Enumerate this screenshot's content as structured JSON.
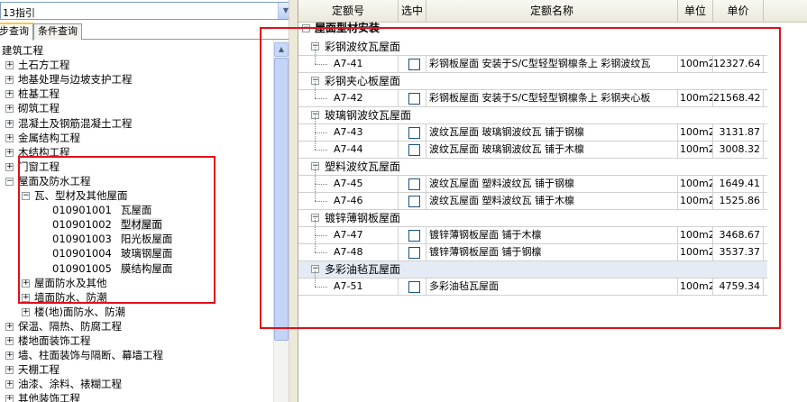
{
  "left": {
    "combo_value": "13指引",
    "tab_active": "步查询",
    "tab_other": "条件查询",
    "tree": [
      {
        "label": "建筑工程",
        "level": 0,
        "exp": ""
      },
      {
        "label": "土石方工程",
        "level": 1,
        "exp": "+"
      },
      {
        "label": "地基处理与边坡支护工程",
        "level": 1,
        "exp": "+"
      },
      {
        "label": "桩基工程",
        "level": 1,
        "exp": "+"
      },
      {
        "label": "砌筑工程",
        "level": 1,
        "exp": "+"
      },
      {
        "label": "混凝土及钢筋混凝土工程",
        "level": 1,
        "exp": "+"
      },
      {
        "label": "金属结构工程",
        "level": 1,
        "exp": "+"
      },
      {
        "label": "木结构工程",
        "level": 1,
        "exp": "+"
      },
      {
        "label": "门窗工程",
        "level": 1,
        "exp": "+"
      },
      {
        "label": "屋面及防水工程",
        "level": 1,
        "exp": "−"
      },
      {
        "label": "瓦、型材及其他屋面",
        "level": 2,
        "exp": "−"
      },
      {
        "code": "010901001",
        "label": "瓦屋面",
        "level": 3,
        "exp": ""
      },
      {
        "code": "010901002",
        "label": "型材屋面",
        "level": 3,
        "exp": "",
        "selected": true
      },
      {
        "code": "010901003",
        "label": "阳光板屋面",
        "level": 3,
        "exp": ""
      },
      {
        "code": "010901004",
        "label": "玻璃钢屋面",
        "level": 3,
        "exp": ""
      },
      {
        "code": "010901005",
        "label": "膜结构屋面",
        "level": 3,
        "exp": ""
      },
      {
        "label": "屋面防水及其他",
        "level": 2,
        "exp": "+"
      },
      {
        "label": "墙面防水、防潮",
        "level": 2,
        "exp": "+"
      },
      {
        "label": "楼(地)面防水、防潮",
        "level": 2,
        "exp": "+"
      },
      {
        "label": "保温、隔热、防腐工程",
        "level": 1,
        "exp": "+"
      },
      {
        "label": "楼地面装饰工程",
        "level": 1,
        "exp": "+"
      },
      {
        "label": "墙、柱面装饰与隔断、幕墙工程",
        "level": 1,
        "exp": "+"
      },
      {
        "label": "天棚工程",
        "level": 1,
        "exp": "+"
      },
      {
        "label": "油漆、涂料、裱糊工程",
        "level": 1,
        "exp": "+"
      },
      {
        "label": "其他装饰工程",
        "level": 1,
        "exp": "+"
      }
    ]
  },
  "grid": {
    "headers": [
      "定额号",
      "选中",
      "定额名称",
      "单位",
      "单价"
    ],
    "section_title": "屋面型材安装",
    "rows": [
      {
        "type": "group",
        "label": "彩钢波纹瓦屋面"
      },
      {
        "type": "item",
        "code": "A7-41",
        "name": "彩钢板屋面 安装于S/C型轻型钢檩条上 彩钢波纹瓦",
        "unit": "100m2",
        "price": "12327.64"
      },
      {
        "type": "group",
        "label": "彩钢夹心板屋面"
      },
      {
        "type": "item",
        "code": "A7-42",
        "name": "彩钢板屋面 安装于S/C型轻型钢檩条上 彩钢夹心板",
        "unit": "100m2",
        "price": "21568.42"
      },
      {
        "type": "group",
        "label": "玻璃钢波纹瓦屋面"
      },
      {
        "type": "item",
        "code": "A7-43",
        "name": "波纹瓦屋面 玻璃钢波纹瓦 铺于钢檩",
        "unit": "100m2",
        "price": "3131.87"
      },
      {
        "type": "item",
        "code": "A7-44",
        "name": "波纹瓦屋面 玻璃钢波纹瓦 铺于木檩",
        "unit": "100m2",
        "price": "3008.32"
      },
      {
        "type": "group",
        "label": "塑料波纹瓦屋面"
      },
      {
        "type": "item",
        "code": "A7-45",
        "name": "波纹瓦屋面 塑料波纹瓦 铺于钢檩",
        "unit": "100m2",
        "price": "1649.41"
      },
      {
        "type": "item",
        "code": "A7-46",
        "name": "波纹瓦屋面 塑料波纹瓦 铺于木檩",
        "unit": "100m2",
        "price": "1525.86"
      },
      {
        "type": "group",
        "label": "镀锌薄钢板屋面"
      },
      {
        "type": "item",
        "code": "A7-47",
        "name": "镀锌薄钢板屋面 铺于木檩",
        "unit": "100m2",
        "price": "3468.67"
      },
      {
        "type": "item",
        "code": "A7-48",
        "name": "镀锌薄钢板屋面 铺于钢檩",
        "unit": "100m2",
        "price": "3537.37"
      },
      {
        "type": "group",
        "label": "多彩油毡瓦屋面",
        "highlight": true
      },
      {
        "type": "item",
        "code": "A7-51",
        "name": "多彩油毡瓦屋面",
        "unit": "100m2",
        "price": "4759.34"
      }
    ]
  },
  "colors": {
    "annotation_red": "#e0101a",
    "selection_gray": "#e8e8e8",
    "group_highlight": "#e4ebf5"
  }
}
